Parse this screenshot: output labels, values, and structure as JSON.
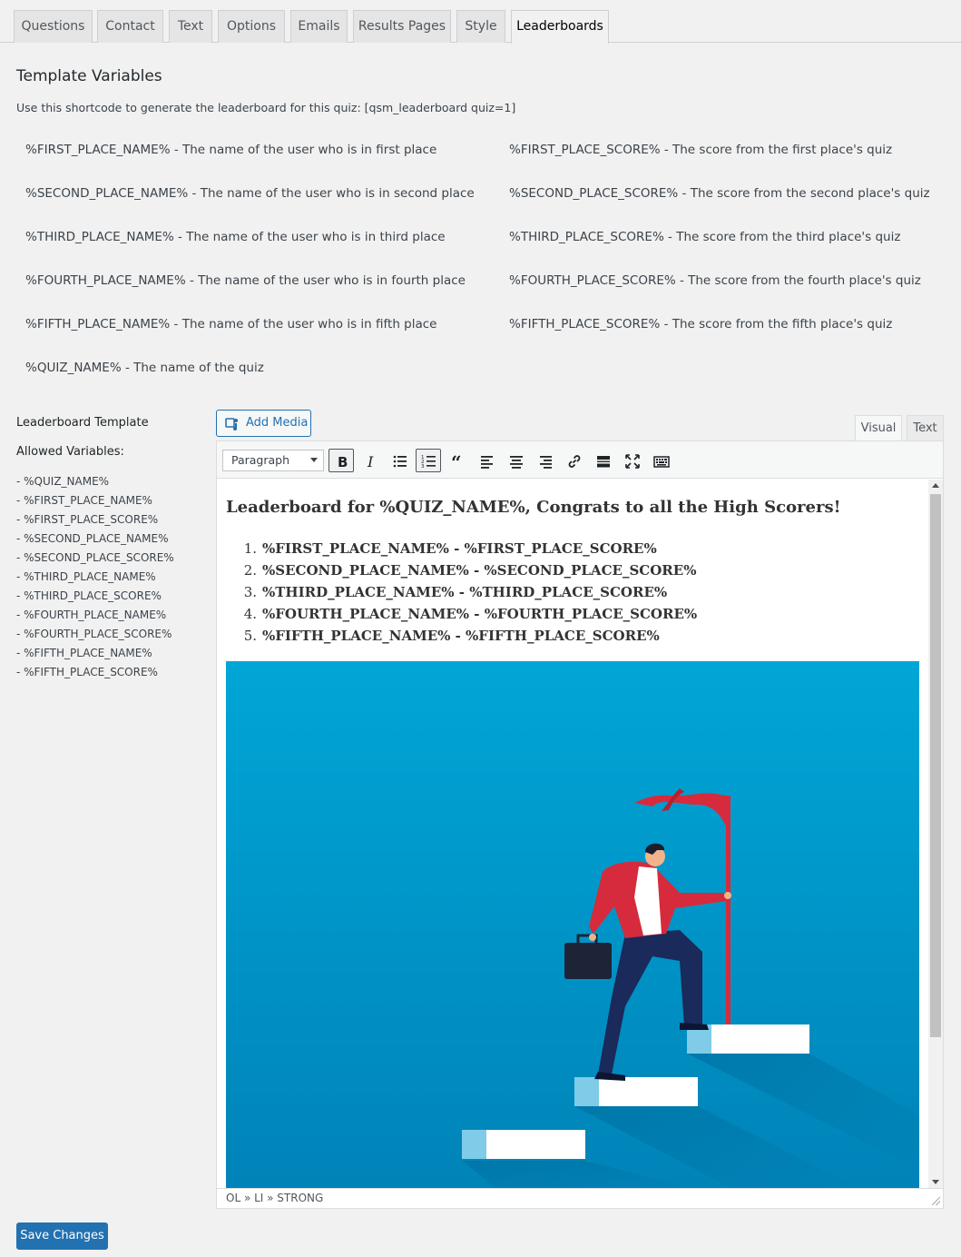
{
  "tabs": [
    {
      "label": "Questions"
    },
    {
      "label": "Contact"
    },
    {
      "label": "Text"
    },
    {
      "label": "Options"
    },
    {
      "label": "Emails"
    },
    {
      "label": "Results Pages"
    },
    {
      "label": "Style"
    },
    {
      "label": "Leaderboards",
      "active": true
    }
  ],
  "template_variables": {
    "title": "Template Variables",
    "shortcode_text": "Use this shortcode to generate the leaderboard for this quiz: [qsm_leaderboard quiz=1]",
    "left": [
      "%FIRST_PLACE_NAME% - The name of the user who is in first place",
      "%SECOND_PLACE_NAME% - The name of the user who is in second place",
      "%THIRD_PLACE_NAME% - The name of the user who is in third place",
      "%FOURTH_PLACE_NAME% - The name of the user who is in fourth place",
      "%FIFTH_PLACE_NAME% - The name of the user who is in fifth place",
      "%QUIZ_NAME% - The name of the quiz"
    ],
    "right": [
      "%FIRST_PLACE_SCORE% - The score from the first place's quiz",
      "%SECOND_PLACE_SCORE% - The score from the second place's quiz",
      "%THIRD_PLACE_SCORE% - The score from the third place's quiz",
      "%FOURTH_PLACE_SCORE% - The score from the fourth place's quiz",
      "%FIFTH_PLACE_SCORE% - The score from the fifth place's quiz"
    ]
  },
  "sidebar": {
    "template_label": "Leaderboard Template",
    "allowed_label": "Allowed Variables:",
    "variables": [
      "- %QUIZ_NAME%",
      "- %FIRST_PLACE_NAME%",
      "- %FIRST_PLACE_SCORE%",
      "- %SECOND_PLACE_NAME%",
      "- %SECOND_PLACE_SCORE%",
      "- %THIRD_PLACE_NAME%",
      "- %THIRD_PLACE_SCORE%",
      "- %FOURTH_PLACE_NAME%",
      "- %FOURTH_PLACE_SCORE%",
      "- %FIFTH_PLACE_NAME%",
      "- %FIFTH_PLACE_SCORE%"
    ]
  },
  "editor": {
    "add_media_label": "Add Media",
    "mode_visual": "Visual",
    "mode_text": "Text",
    "format_select": "Paragraph",
    "toolbar_icons": [
      "bold-icon",
      "italic-icon",
      "bullet-list-icon",
      "numbered-list-icon",
      "blockquote-icon",
      "align-left-icon",
      "align-center-icon",
      "align-right-icon",
      "link-icon",
      "read-more-icon",
      "fullscreen-icon",
      "toolbar-toggle-icon"
    ],
    "heading": "Leaderboard for %QUIZ_NAME%, Congrats to all the High Scorers!",
    "list": [
      {
        "num": "1.",
        "text": "%FIRST_PLACE_NAME% - %FIRST_PLACE_SCORE%"
      },
      {
        "num": "2.",
        "text": "%SECOND_PLACE_NAME% - %SECOND_PLACE_SCORE%"
      },
      {
        "num": "3.",
        "text": "%THIRD_PLACE_NAME% - %THIRD_PLACE_SCORE%"
      },
      {
        "num": "4.",
        "text": "%FOURTH_PLACE_NAME% - %FOURTH_PLACE_SCORE%"
      },
      {
        "num": "5.",
        "text": "%FIFTH_PLACE_NAME%  - %FIFTH_PLACE_SCORE%"
      }
    ],
    "statusbar_path": "OL » LI » STRONG"
  },
  "save_label": "Save Changes",
  "colors": {
    "accent": "#2271b1",
    "hero_top": "#00a6d6",
    "hero_bottom": "#0083b8",
    "flag": "#d62b3c",
    "jacket": "#d62b3c",
    "pants": "#1a2a5a"
  }
}
